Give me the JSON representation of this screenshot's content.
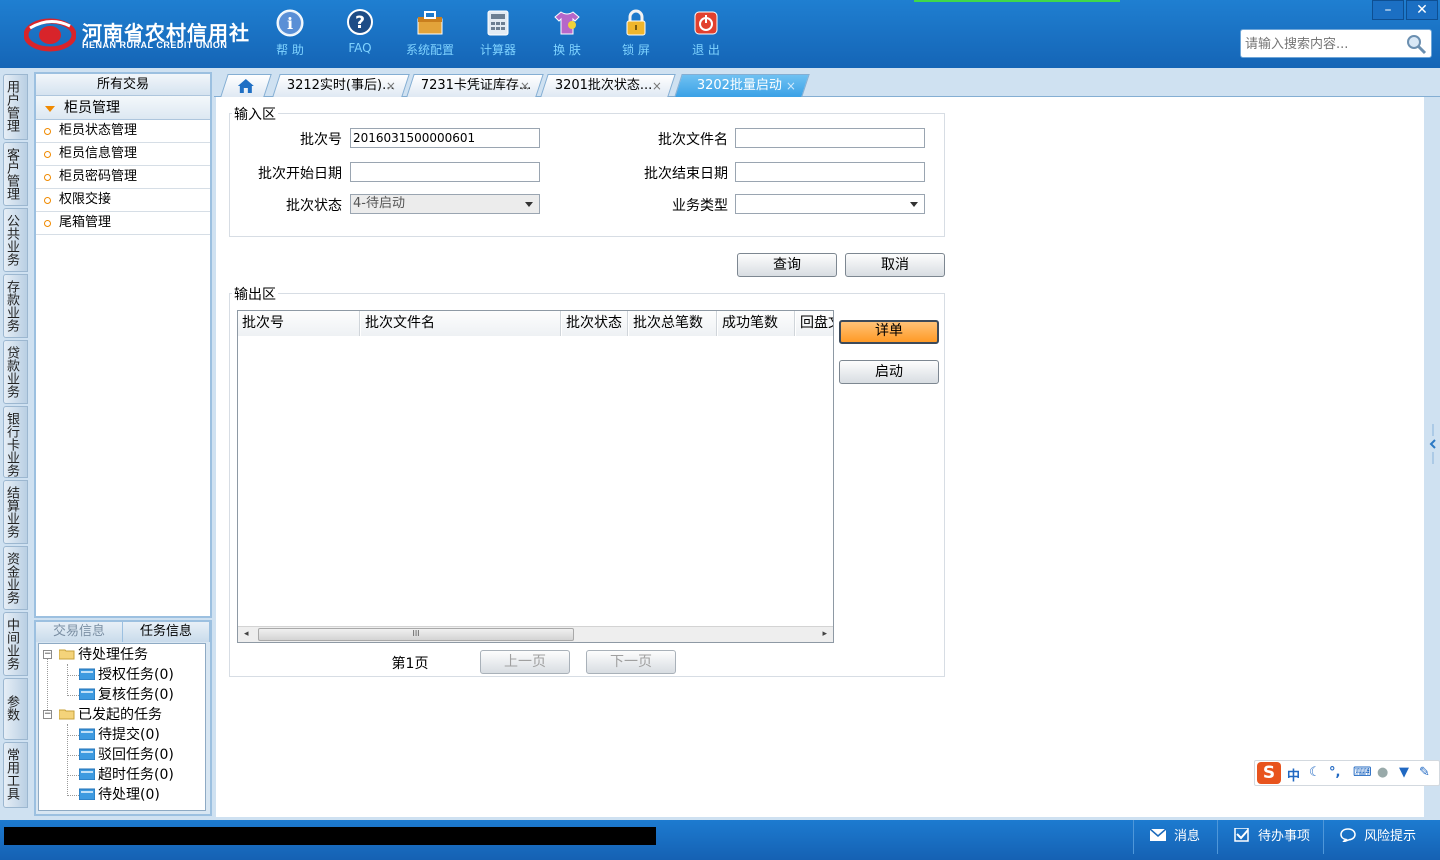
{
  "header": {
    "brand_cn": "河南省农村信用社",
    "brand_en": "HENAN RURAL CREDIT UNION",
    "tools": [
      {
        "label": "帮 助",
        "icon": "help-icon"
      },
      {
        "label": "FAQ",
        "icon": "faq-icon"
      },
      {
        "label": "系统配置",
        "icon": "toolbox-icon"
      },
      {
        "label": "计算器",
        "icon": "calculator-icon"
      },
      {
        "label": "换 肤",
        "icon": "shirt-icon"
      },
      {
        "label": "锁 屏",
        "icon": "lock-icon"
      },
      {
        "label": "退 出",
        "icon": "power-icon"
      }
    ],
    "search_placeholder": "请输入搜索内容...",
    "minimize": "–",
    "close": "✕"
  },
  "vnav": {
    "items": [
      "用户管理",
      "客户管理",
      "公共业务",
      "存款业务",
      "贷款业务",
      "银行卡业务",
      "结算业务",
      "资金业务",
      "中间业务",
      "参数",
      "常用工具"
    ]
  },
  "txpanel": {
    "title": "所有交易",
    "group": "柜员管理",
    "items": [
      "柜员状态管理",
      "柜员信息管理",
      "柜员密码管理",
      "权限交接",
      "尾箱管理"
    ]
  },
  "taskpanel": {
    "tab_tx": "交易信息",
    "tab_task": "任务信息",
    "pending": "待处理任务",
    "pending_children": [
      "授权任务(0)",
      "复核任务(0)"
    ],
    "started": "已发起的任务",
    "started_children": [
      "待提交(0)",
      "驳回任务(0)",
      "超时任务(0)",
      "待处理(0)"
    ]
  },
  "tabs": [
    {
      "label": "3212实时(事后)...",
      "close": "×"
    },
    {
      "label": "7231卡凭证库存...",
      "close": "×"
    },
    {
      "label": "3201批次状态...",
      "close": "×"
    },
    {
      "label": "3202批量启动",
      "close": "×"
    }
  ],
  "form": {
    "input_legend": "输入区",
    "batch_no_label": "批次号",
    "batch_no_value": "2016031500000601",
    "batch_file_label": "批次文件名",
    "batch_file_value": "",
    "start_date_label": "批次开始日期",
    "start_date_value": "",
    "end_date_label": "批次结束日期",
    "end_date_value": "",
    "status_label": "批次状态",
    "status_value": "4-待启动",
    "biz_type_label": "业务类型",
    "biz_type_value": "",
    "query_btn": "查询",
    "cancel_btn": "取消"
  },
  "output": {
    "legend": "输出区",
    "columns": [
      "批次号",
      "批次文件名",
      "批次状态",
      "批次总笔数",
      "成功笔数",
      "回盘文"
    ],
    "scroll_grip": "III",
    "detail_btn": "详单",
    "start_btn": "启动",
    "page_label": "第1页",
    "prev_btn": "上一页",
    "next_btn": "下一页"
  },
  "ime": {
    "logo": "S",
    "mode": "中"
  },
  "statusbar": {
    "msg": "消息",
    "todo": "待办事项",
    "risk": "风险提示"
  }
}
